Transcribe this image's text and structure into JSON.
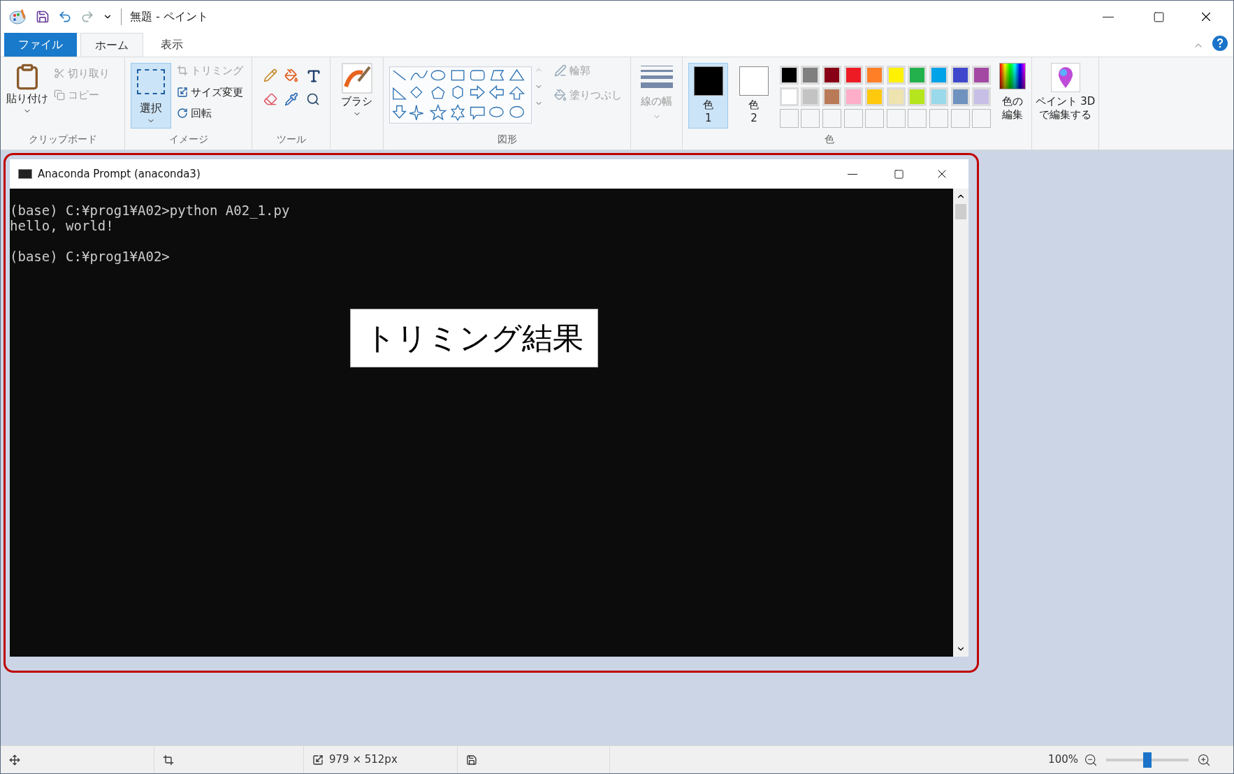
{
  "window": {
    "title": "無題 - ペイント"
  },
  "tabs": [
    {
      "label": "ファイル",
      "kind": "file",
      "selected": false
    },
    {
      "label": "ホーム",
      "kind": "tab",
      "selected": true
    },
    {
      "label": "表示",
      "kind": "tab",
      "selected": false
    }
  ],
  "ribbon": {
    "clipboard": {
      "label": "クリップボード",
      "paste": "貼り付け",
      "cut": {
        "label": "切り取り",
        "disabled": true
      },
      "copy": {
        "label": "コピー",
        "disabled": true
      }
    },
    "image": {
      "label": "イメージ",
      "select": {
        "label": "選択",
        "selected": true
      },
      "trim": {
        "label": "トリミング",
        "disabled": true
      },
      "resize": {
        "label": "サイズ変更",
        "disabled": false
      },
      "rotate": {
        "label": "回転",
        "disabled": false
      }
    },
    "tools": {
      "label": "ツール"
    },
    "brush": {
      "label": "ブラシ"
    },
    "shapes": {
      "label": "図形",
      "outline": {
        "label": "輪郭",
        "disabled": true
      },
      "fill": {
        "label": "塗りつぶし",
        "disabled": true
      }
    },
    "line_width": {
      "label": "線の幅",
      "disabled": true
    },
    "colors": {
      "label": "色",
      "current": [
        {
          "label": "色",
          "number": "1",
          "selected": true,
          "color": "#000000"
        },
        {
          "label": "色",
          "number": "2",
          "selected": false,
          "color": "#ffffff"
        }
      ],
      "palette": [
        {
          "color": "#000000"
        },
        {
          "color": "#7f7f7f"
        },
        {
          "color": "#880015"
        },
        {
          "color": "#ed1c24"
        },
        {
          "color": "#ff7f27"
        },
        {
          "color": "#fff200"
        },
        {
          "color": "#22b14c"
        },
        {
          "color": "#00a2e8"
        },
        {
          "color": "#3f48cc"
        },
        {
          "color": "#a349a4"
        },
        {
          "color": "#ffffff"
        },
        {
          "color": "#c3c3c3"
        },
        {
          "color": "#b97a57"
        },
        {
          "color": "#ffaec9"
        },
        {
          "color": "#ffc90e"
        },
        {
          "color": "#efe4b0"
        },
        {
          "color": "#b5e61d"
        },
        {
          "color": "#99d9ea"
        },
        {
          "color": "#7092be"
        },
        {
          "color": "#c8bfe7"
        }
      ],
      "edit": [
        "色の",
        "編集"
      ]
    },
    "paint3d": [
      "ペイント 3D",
      "で編集する"
    ]
  },
  "canvas": {
    "terminal": {
      "title": "Anaconda Prompt (anaconda3)",
      "blocks": [
        [
          "(base) C:¥prog1¥A02>python A02_1.py",
          "hello, world!"
        ],
        [
          "(base) C:¥prog1¥A02>"
        ]
      ]
    },
    "callout": "トリミング結果"
  },
  "status_bar": {
    "size": "979 × 512px",
    "zoom": "100%",
    "zoom_level": {
      "level": 0.5
    }
  }
}
